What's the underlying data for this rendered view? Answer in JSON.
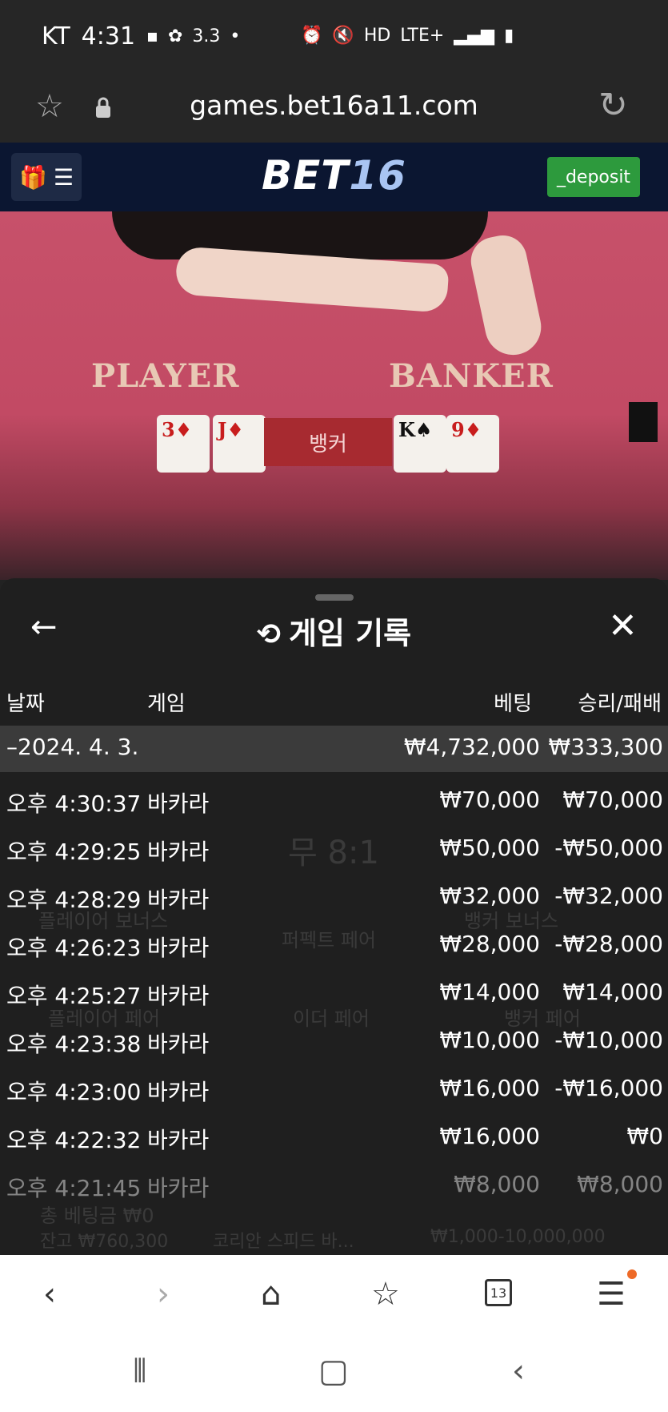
{
  "status_bar": {
    "carrier": "KT",
    "time": "4:31",
    "signal_value": "3.3",
    "network": "LTE+"
  },
  "browser": {
    "url": "games.bet16a11.com"
  },
  "app_header": {
    "logo_text": "BET",
    "logo_number": "16",
    "deposit_label": "_deposit"
  },
  "game_view": {
    "player_label": "PLAYER",
    "banker_label": "BANKER",
    "result_label": "뱅커",
    "player_cards": [
      {
        "rank": "3",
        "suit": "♦"
      },
      {
        "rank": "J",
        "suit": "♦"
      }
    ],
    "banker_cards": [
      {
        "rank": "K",
        "suit": "♠"
      },
      {
        "rank": "9",
        "suit": "♦"
      }
    ]
  },
  "history_panel": {
    "title": "게임 기록",
    "columns": {
      "date": "날짜",
      "game": "게임",
      "bet": "베팅",
      "win_loss": "승리/패배"
    },
    "summary": {
      "date": "–2024. 4. 3.",
      "bet": "₩4,732,000",
      "win_loss": "₩333,300"
    },
    "rows": [
      {
        "time": "오후 4:30:37",
        "game": "바카라",
        "bet": "₩70,000",
        "result": "₩70,000"
      },
      {
        "time": "오후 4:29:25",
        "game": "바카라",
        "bet": "₩50,000",
        "result": "-₩50,000"
      },
      {
        "time": "오후 4:28:29",
        "game": "바카라",
        "bet": "₩32,000",
        "result": "-₩32,000"
      },
      {
        "time": "오후 4:26:23",
        "game": "바카라",
        "bet": "₩28,000",
        "result": "-₩28,000"
      },
      {
        "time": "오후 4:25:27",
        "game": "바카라",
        "bet": "₩14,000",
        "result": "₩14,000"
      },
      {
        "time": "오후 4:23:38",
        "game": "바카라",
        "bet": "₩10,000",
        "result": "-₩10,000"
      },
      {
        "time": "오후 4:23:00",
        "game": "바카라",
        "bet": "₩16,000",
        "result": "-₩16,000"
      },
      {
        "time": "오후 4:22:32",
        "game": "바카라",
        "bet": "₩16,000",
        "result": "₩0"
      },
      {
        "time": "오후 4:21:45",
        "game": "바카라",
        "bet": "₩8,000",
        "result": "₩8,000"
      }
    ],
    "background_text": {
      "balance": "잔고 ₩760,300",
      "table_name": "코리안 스피드 바...",
      "limits": "₩1,000-10,000,000",
      "total_bet": "총 베팅금 ₩0",
      "tie": "무 8:1",
      "player_bonus": "플레이어 보너스",
      "banker_bonus": "뱅커 보너스",
      "perfect_pair": "퍼펙트 페어",
      "either_pair": "이더 페어",
      "player_pair": "플레이어 페어",
      "banker_pair": "뱅커 페어"
    }
  },
  "browser_nav": {
    "tab_count": "13"
  },
  "colors": {
    "header_bg": "#0b1631",
    "deposit_green": "#2d9a3d",
    "felt_red": "#c7516a",
    "panel_bg": "#1f1f1f",
    "summary_bg": "#3b3b3b"
  }
}
